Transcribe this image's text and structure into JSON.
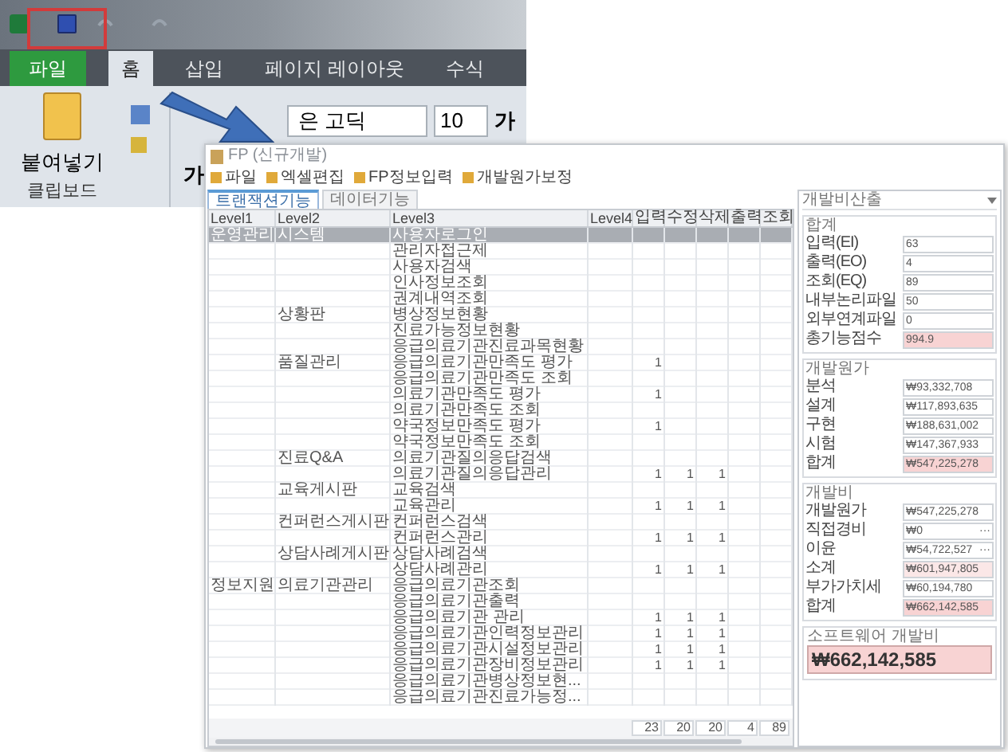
{
  "excel": {
    "tabs": [
      {
        "label": "파일",
        "kind": "file",
        "selected": false
      },
      {
        "label": "홈",
        "kind": "tab",
        "selected": true
      },
      {
        "label": "삽입",
        "kind": "tab",
        "selected": false
      },
      {
        "label": "페이지 레이아웃",
        "kind": "tab",
        "selected": false
      },
      {
        "label": "수식",
        "kind": "tab",
        "selected": false
      }
    ],
    "paste_label": "붙여넣기",
    "group_label": "클립보드",
    "bold_glyph": "가",
    "font_name": "은 고딕",
    "font_size": "10",
    "font_glyph": "가"
  },
  "app": {
    "title": "FP (신규개발)",
    "toolbar": [
      "파일",
      "엑셀편집",
      "FP정보입력",
      "개발원가보정"
    ],
    "tabs": [
      {
        "label": "트랜잭션기능",
        "selected": true
      },
      {
        "label": "데이터기능",
        "selected": false
      }
    ],
    "columns": [
      "Level1",
      "Level2",
      "Level3",
      "Level4",
      "입력",
      "수정",
      "삭제",
      "출력",
      "조회"
    ],
    "rows": [
      {
        "level1": "운영관리",
        "level2": "시스템",
        "level3": "사용자로그인",
        "selected": true
      },
      {
        "level3": "관리자접근제",
        "selected": false
      },
      {
        "level3": "사용자검색",
        "selected": false
      },
      {
        "level3": "인사정보조회",
        "selected": false
      },
      {
        "level3": "권계내역조회",
        "selected": false
      },
      {
        "level2": "상황판",
        "level3": "병상정보현황",
        "selected": false
      },
      {
        "level3": "진료가능정보현황",
        "selected": false
      },
      {
        "level3": "응급의료기관진료과목현황",
        "selected": false
      },
      {
        "level2": "품질관리",
        "level3": "응급의료기관만족도 평가",
        "input": "1",
        "selected": false
      },
      {
        "level3": "응급의료기관만족도 조회",
        "selected": false
      },
      {
        "level3": "의료기관만족도 평가",
        "input": "1",
        "selected": false
      },
      {
        "level3": "의료기관만족도 조회",
        "selected": false
      },
      {
        "level3": "약국정보만족도 평가",
        "input": "1",
        "selected": false
      },
      {
        "level3": "약국정보만족도 조회",
        "selected": false
      },
      {
        "level2": "진료Q&A",
        "level3": "의료기관질의응답검색",
        "selected": false
      },
      {
        "level3": "의료기관질의응답관리",
        "input": "1",
        "update": "1",
        "delete": "1",
        "selected": false
      },
      {
        "level2": "교육게시판",
        "level3": "교육검색",
        "selected": false
      },
      {
        "level3": "교육관리",
        "input": "1",
        "update": "1",
        "delete": "1",
        "selected": false
      },
      {
        "level2": "컨퍼런스게시판",
        "level3": "컨퍼런스검색",
        "selected": false
      },
      {
        "level3": "컨퍼런스관리",
        "input": "1",
        "update": "1",
        "delete": "1",
        "selected": false
      },
      {
        "level2": "상담사례게시판",
        "level3": "상담사례검색",
        "selected": false
      },
      {
        "level3": "상담사례관리",
        "input": "1",
        "update": "1",
        "delete": "1",
        "selected": false
      },
      {
        "level1": "정보지원",
        "level2": "의료기관관리",
        "level3": "응급의료기관조회",
        "selected": false
      },
      {
        "level3": "응급의료기관출력",
        "selected": false
      },
      {
        "level3": "응급의료기관 관리",
        "input": "1",
        "update": "1",
        "delete": "1",
        "selected": false
      },
      {
        "level3": "응급의료기관인력정보관리",
        "input": "1",
        "update": "1",
        "delete": "1",
        "selected": false
      },
      {
        "level3": "응급의료기관시설정보관리",
        "input": "1",
        "update": "1",
        "delete": "1",
        "selected": false
      },
      {
        "level3": "응급의료기관장비정보관리",
        "input": "1",
        "update": "1",
        "delete": "1",
        "selected": false
      },
      {
        "level3": "응급의료기관병상정보현...",
        "selected": false
      },
      {
        "level3": "응급의료기관진료가능정...",
        "selected": false
      }
    ],
    "totals": [
      "23",
      "20",
      "20",
      "4",
      "89"
    ],
    "panel": {
      "title": "개발비산출",
      "groups": [
        {
          "title": "합계",
          "fields": [
            {
              "label": "입력(EI)",
              "value": "63",
              "color": "#ffffff"
            },
            {
              "label": "출력(EO)",
              "value": "4",
              "color": "#ffffff"
            },
            {
              "label": "조회(EQ)",
              "value": "89",
              "color": "#ffffff"
            },
            {
              "label": "내부논리파일",
              "value": "50",
              "color": "#ffffff"
            },
            {
              "label": "외부연계파일",
              "value": "0",
              "color": "#ffffff"
            },
            {
              "label": "총기능점수",
              "value": "994.9",
              "color": "#f8d3d3"
            }
          ]
        },
        {
          "title": "개발원가",
          "fields": [
            {
              "label": "분석",
              "value": "₩93,332,708",
              "color": "#ffffff"
            },
            {
              "label": "설계",
              "value": "₩117,893,635",
              "color": "#ffffff"
            },
            {
              "label": "구현",
              "value": "₩188,631,002",
              "color": "#ffffff"
            },
            {
              "label": "시험",
              "value": "₩147,367,933",
              "color": "#ffffff"
            },
            {
              "label": "합계",
              "value": "₩547,225,278",
              "color": "#f8d3d3"
            }
          ]
        },
        {
          "title": "개발비",
          "fields": [
            {
              "label": "개발원가",
              "value": "₩547,225,278",
              "color": "#ffffff"
            },
            {
              "label": "직접경비",
              "value": "₩0",
              "color": "#ffffff",
              "action": "···"
            },
            {
              "label": "이윤",
              "value": "₩54,722,527",
              "color": "#ffffff",
              "action": "···"
            },
            {
              "label": "소계",
              "value": "₩601,947,805",
              "color": "#fbe7e7"
            },
            {
              "label": "부가가치세",
              "value": "₩60,194,780",
              "color": "#ffffff"
            },
            {
              "label": "합계",
              "value": "₩662,142,585",
              "color": "#f8d3d3"
            }
          ]
        }
      ],
      "total": {
        "title": "소프트웨어 개발비",
        "value": "₩662,142,585"
      }
    }
  }
}
